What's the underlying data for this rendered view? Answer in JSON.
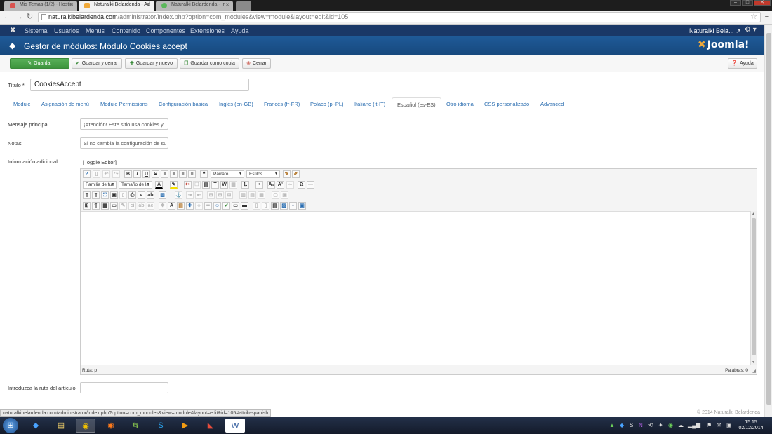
{
  "browser": {
    "tabs": [
      {
        "label": "Mis Temas (1/2) - Hostin",
        "active": false
      },
      {
        "label": "Naturalki Belardenda - Ad",
        "active": true
      },
      {
        "label": "Naturalki Belardenda - In",
        "active": false
      }
    ],
    "url_host": "naturalkibelardenda.com",
    "url_path": "/administrator/index.php?option=com_modules&view=module&layout=edit&id=105",
    "status_url": "naturalkibelardenda.com/administrator/index.php?option=com_modules&view=module&layout=edit&id=105#attrib-spanish"
  },
  "topnav": {
    "items": [
      "Sistema",
      "Usuarios",
      "Menús",
      "Contenido",
      "Componentes",
      "Extensiones",
      "Ayuda"
    ],
    "site_link": "Naturalki Bela..."
  },
  "header": {
    "page_title": "Gestor de módulos: Módulo Cookies accept",
    "brand": "Joomla!"
  },
  "toolbar": {
    "save": "Guardar",
    "save_close": "Guardar y cerrar",
    "save_new": "Guardar y nuevo",
    "save_copy": "Guardar como copia",
    "close": "Cerrar",
    "help": "Ayuda"
  },
  "form": {
    "title_label": "Título *",
    "title_value": "CookiesAccept",
    "tabs": [
      "Module",
      "Asignación de menú",
      "Module Permissions",
      "Configuración básica",
      "Inglés (en-GB)",
      "Francés (fr-FR)",
      "Polaco (pl-PL)",
      "Italiano (it-IT)",
      "Español (es-ES)",
      "Otro idioma",
      "CSS personalizado",
      "Advanced"
    ],
    "active_tab": "Español (es-ES)",
    "main_message_label": "Mensaje principal",
    "main_message_value": "¡Atención! Este sitio usa cookies y",
    "notes_label": "Notas",
    "notes_value": "Si no cambia la configuración de su",
    "extra_info_label": "Información adicional",
    "toggle_editor": "[Toggle Editor]",
    "article_path_label": "Introduzca la ruta del artículo",
    "article_path_value": ""
  },
  "editor": {
    "format_select": "Párrafo",
    "styles_select": "Estilos",
    "font_family_select": "Familia de fue",
    "font_size_select": "Tamaño de la",
    "path_text": "Ruta: p",
    "word_count": "Palabras: 0"
  },
  "footer": {
    "copyright": "© 2014 Naturalki Belardenda"
  },
  "taskbar": {
    "time": "15:15",
    "date": "02/12/2014"
  },
  "colors": {
    "navbar": "#1a3867",
    "header": "#1f5a98",
    "primary_button": "#46a546",
    "link": "#2a6db0"
  }
}
